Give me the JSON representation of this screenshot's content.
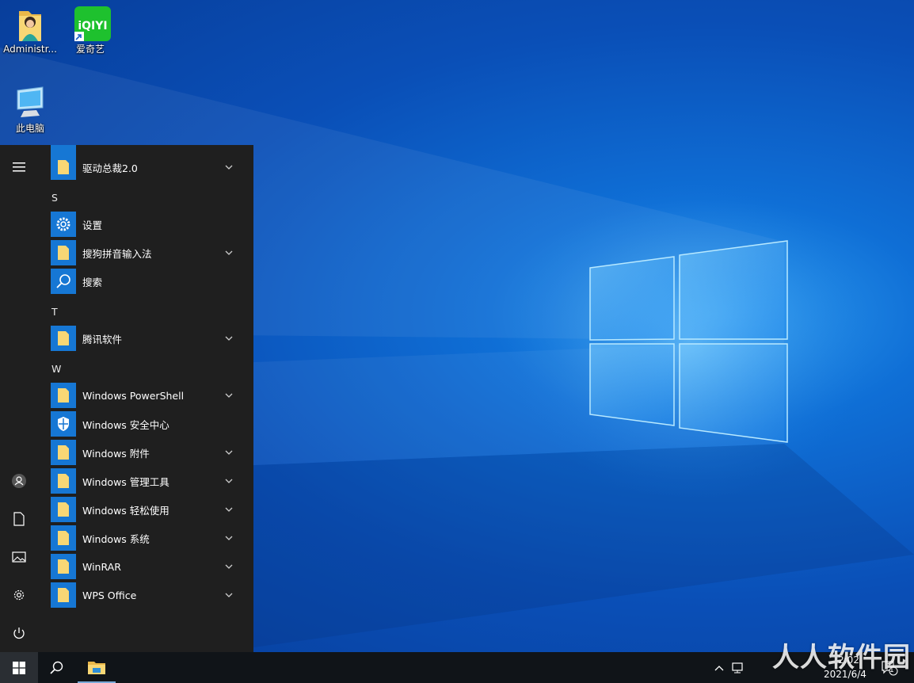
{
  "desktop": {
    "icons": [
      {
        "label": "Administr..."
      },
      {
        "label": "爱奇艺"
      },
      {
        "label": "此电脑"
      }
    ]
  },
  "start_menu": {
    "items": [
      {
        "label": "驱动总裁2.0",
        "icon": "folder-icon",
        "expandable": true
      },
      {
        "letter": "S"
      },
      {
        "label": "设置",
        "icon": "gear-icon",
        "expandable": false
      },
      {
        "label": "搜狗拼音输入法",
        "icon": "folder-icon",
        "expandable": true
      },
      {
        "label": "搜索",
        "icon": "search-icon",
        "expandable": false
      },
      {
        "letter": "T"
      },
      {
        "label": "腾讯软件",
        "icon": "folder-icon",
        "expandable": true
      },
      {
        "letter": "W"
      },
      {
        "label": "Windows PowerShell",
        "icon": "folder-icon",
        "expandable": true
      },
      {
        "label": "Windows 安全中心",
        "icon": "shield-icon",
        "expandable": false
      },
      {
        "label": "Windows 附件",
        "icon": "folder-icon",
        "expandable": true
      },
      {
        "label": "Windows 管理工具",
        "icon": "folder-icon",
        "expandable": true
      },
      {
        "label": "Windows 轻松使用",
        "icon": "folder-icon",
        "expandable": true
      },
      {
        "label": "Windows 系统",
        "icon": "folder-icon",
        "expandable": true
      },
      {
        "label": "WinRAR",
        "icon": "folder-icon",
        "expandable": true
      },
      {
        "label": "WPS Office",
        "icon": "folder-icon",
        "expandable": true
      }
    ],
    "rail": [
      "hamburger-icon",
      "user-icon",
      "document-icon",
      "pictures-icon",
      "gear-icon",
      "power-icon"
    ]
  },
  "taskbar": {
    "tray": {
      "time": "2:02",
      "date": "2021/6/4",
      "notification_count": "1"
    }
  },
  "watermark": {
    "text": "人人软件园"
  },
  "colors": {
    "tile": "#1677d4",
    "start_bg": "#1f1f1f",
    "taskbar_bg": "#101418",
    "folder": "#f8d775"
  }
}
